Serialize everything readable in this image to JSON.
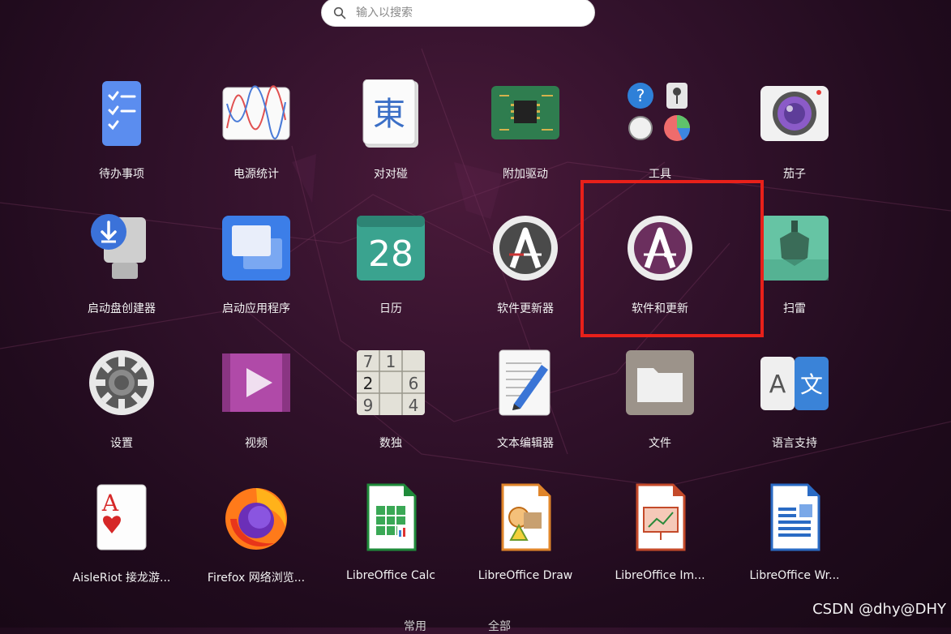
{
  "search": {
    "placeholder": "输入以搜索"
  },
  "apps": [
    {
      "label": "待办事项",
      "icon": "todo-list-icon"
    },
    {
      "label": "电源统计",
      "icon": "power-statistics-icon"
    },
    {
      "label": "对对碰",
      "icon": "mahjongg-icon"
    },
    {
      "label": "附加驱动",
      "icon": "chip-driver-icon"
    },
    {
      "label": "工具",
      "icon": "utilities-folder-icon"
    },
    {
      "label": "茄子",
      "icon": "camera-icon"
    },
    {
      "label": "启动盘创建器",
      "icon": "usb-creator-icon"
    },
    {
      "label": "启动应用程序",
      "icon": "startup-apps-icon"
    },
    {
      "label": "日历",
      "icon": "calendar-icon",
      "text": "28"
    },
    {
      "label": "软件更新器",
      "icon": "software-updater-icon"
    },
    {
      "label": "软件和更新",
      "icon": "software-properties-icon"
    },
    {
      "label": "扫雷",
      "icon": "mines-icon"
    },
    {
      "label": "设置",
      "icon": "settings-gear-icon"
    },
    {
      "label": "视频",
      "icon": "video-player-icon"
    },
    {
      "label": "数独",
      "icon": "sudoku-icon",
      "cells": [
        "7",
        "1",
        "2",
        "6",
        "9",
        "4"
      ]
    },
    {
      "label": "文本编辑器",
      "icon": "text-editor-icon"
    },
    {
      "label": "文件",
      "icon": "files-folder-icon"
    },
    {
      "label": "语言支持",
      "icon": "language-support-icon",
      "glyph_a": "A",
      "glyph_b": "文"
    },
    {
      "label": "AisleRiot 接龙游...",
      "icon": "solitaire-card-icon",
      "glyph": "A"
    },
    {
      "label": "Firefox 网络浏览...",
      "icon": "firefox-icon"
    },
    {
      "label": "LibreOffice Calc",
      "icon": "libreoffice-calc-icon"
    },
    {
      "label": "LibreOffice Draw",
      "icon": "libreoffice-draw-icon"
    },
    {
      "label": "LibreOffice Im...",
      "icon": "libreoffice-impress-icon"
    },
    {
      "label": "LibreOffice Wr...",
      "icon": "libreoffice-writer-icon"
    }
  ],
  "tabs": {
    "frequent": "常用",
    "all": "全部"
  },
  "watermark": "CSDN @dhy@DHY",
  "colors": {
    "highlight": "#e8201a",
    "ubuntu_purple": "#5e2750",
    "accent_orange": "#e95420"
  }
}
